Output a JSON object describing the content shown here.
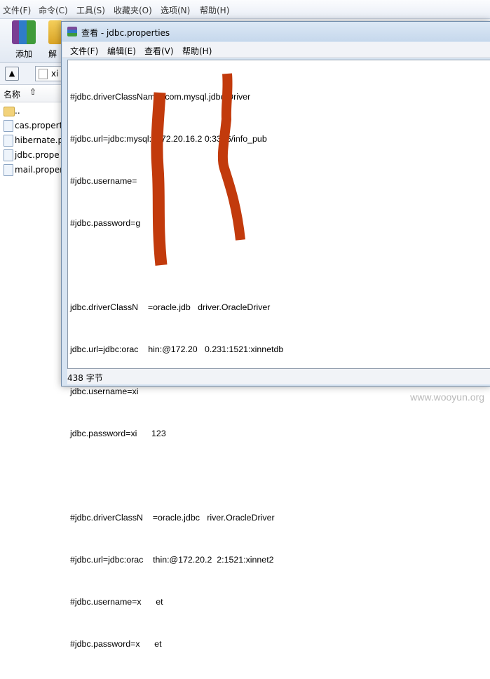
{
  "background_app": {
    "menu": [
      "文件(F)",
      "命令(C)",
      "工具(S)",
      "收藏夹(O)",
      "选项(N)",
      "帮助(H)"
    ],
    "toolbar": {
      "add_label": "添加",
      "extract_label": "解"
    },
    "address_text": "xi",
    "column_header": {
      "name_label": "名称"
    },
    "files": [
      "..",
      "cas.propert",
      "hibernate.p",
      "jdbc.prope",
      "mail.proper"
    ]
  },
  "viewer": {
    "title": "查看 - jdbc.properties",
    "menu": [
      "文件(F)",
      "编辑(E)",
      "查看(V)",
      "帮助(H)"
    ],
    "lines": [
      "#jdbc.driverClassName=com.mysql.jdbc.Driver",
      "#jdbc.url=jdbc:mysql://172.20.16.2 0:3306/info_pub",
      "#jdbc.username=",
      "#jdbc.password=g",
      "",
      "jdbc.driverClassN    =oracle.jdb   driver.OracleDriver",
      "jdbc.url=jdbc:orac    hin:@172.20   0.231:1521:xinnetdb",
      "jdbc.username=xi",
      "jdbc.password=xi      123",
      "",
      "#jdbc.driverClassN    =oracle.jdbc   river.OracleDriver",
      "#jdbc.url=jdbc:orac    thin:@172.20.2  2:1521:xinnet2",
      "#jdbc.username=x      et",
      "#jdbc.password=x      et"
    ],
    "status": "438 字节"
  },
  "watermark": "www.wooyun.org",
  "colors": {
    "redaction": "#c23a0c",
    "window_frame": "#d7e4f2"
  }
}
